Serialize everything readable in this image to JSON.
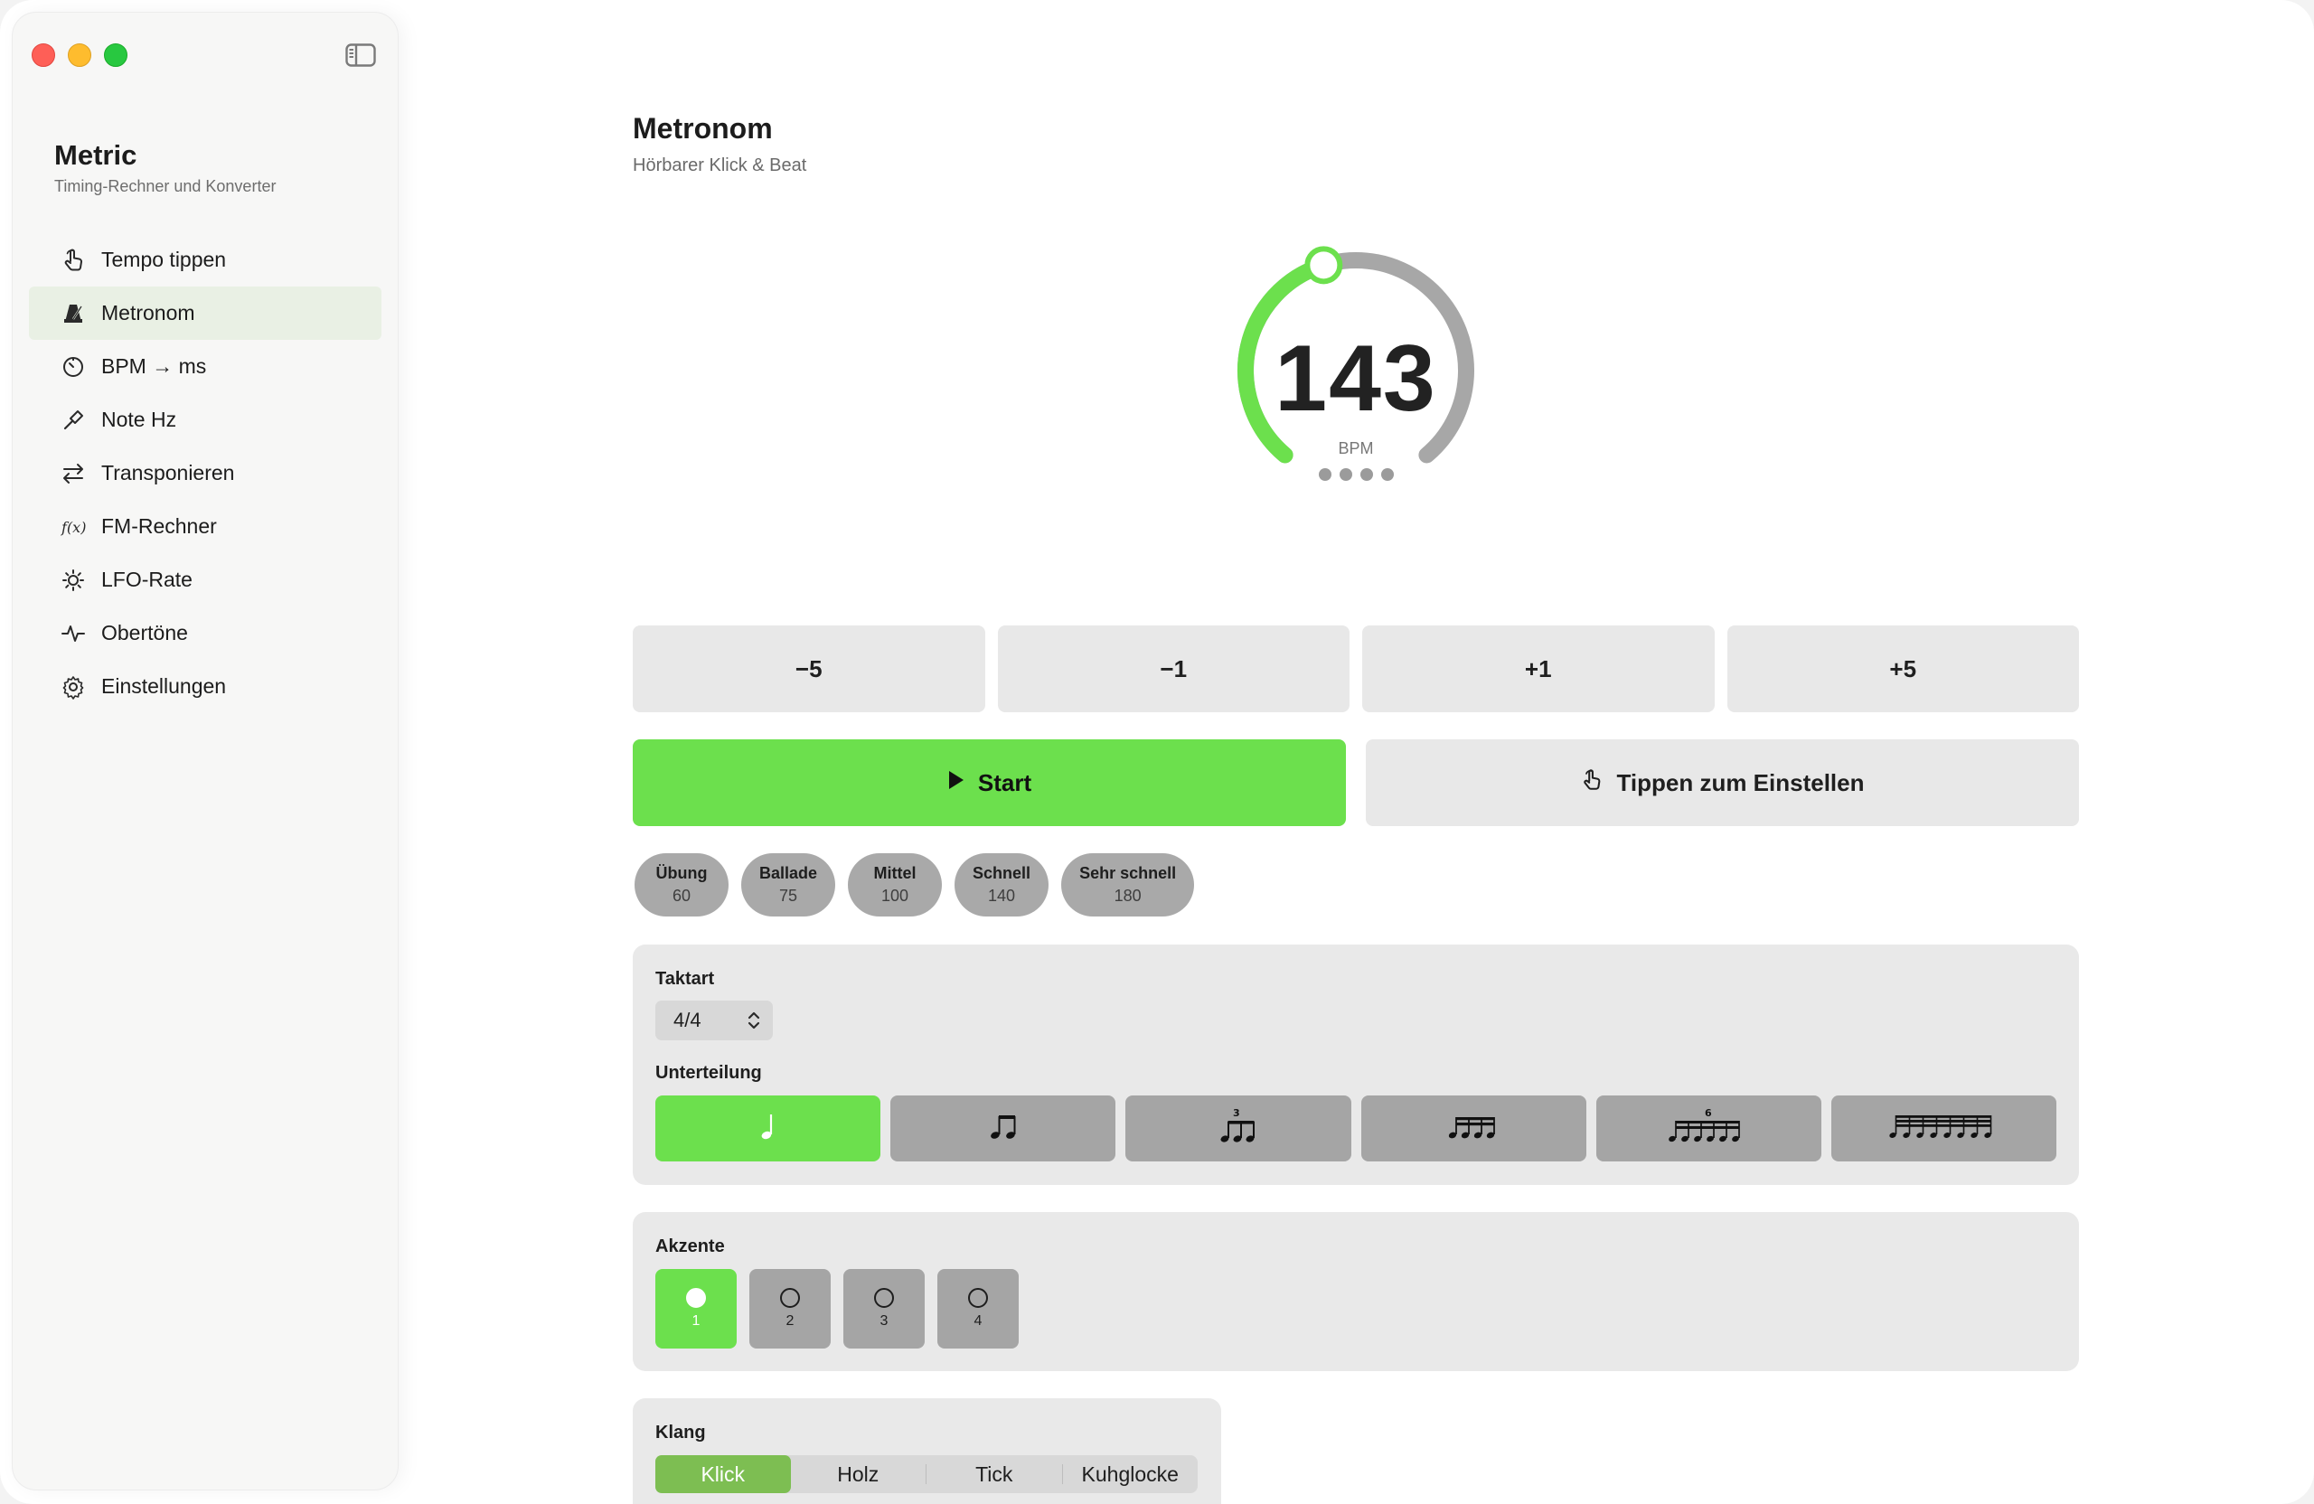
{
  "app": {
    "title": "Metric",
    "subtitle": "Timing-Rechner und Konverter"
  },
  "sidebar": {
    "items": [
      {
        "label": "Tempo tippen",
        "icon": "tap-hand-icon",
        "active": false
      },
      {
        "label": "Metronom",
        "icon": "metronome-icon",
        "active": true
      },
      {
        "label": "BPM → ms",
        "icon": "timer-icon",
        "active": false
      },
      {
        "label": "Note Hz",
        "icon": "tuning-fork-icon",
        "active": false
      },
      {
        "label": "Transponieren",
        "icon": "arrows-swap-icon",
        "active": false
      },
      {
        "label": "FM-Rechner",
        "icon": "function-icon",
        "active": false
      },
      {
        "label": "LFO-Rate",
        "icon": "sun-wave-icon",
        "active": false
      },
      {
        "label": "Obertöne",
        "icon": "waveform-icon",
        "active": false
      },
      {
        "label": "Einstellungen",
        "icon": "gear-icon",
        "active": false
      }
    ]
  },
  "main": {
    "title": "Metronom",
    "subtitle": "Hörbarer Klick & Beat",
    "bpm": {
      "value": "143",
      "unit": "BPM",
      "range_min": 20,
      "range_max": 300,
      "beats": 4
    },
    "steps": [
      "−5",
      "−1",
      "+1",
      "+5"
    ],
    "start_label": "Start",
    "tap_label": "Tippen zum Einstellen",
    "presets": [
      {
        "name": "Übung",
        "bpm": "60"
      },
      {
        "name": "Ballade",
        "bpm": "75"
      },
      {
        "name": "Mittel",
        "bpm": "100"
      },
      {
        "name": "Schnell",
        "bpm": "140"
      },
      {
        "name": "Sehr schnell",
        "bpm": "180"
      }
    ],
    "meter": {
      "label": "Taktart",
      "value": "4/4",
      "subdivision_label": "Unterteilung",
      "subdivisions": [
        {
          "name": "quarter-note-icon",
          "active": true
        },
        {
          "name": "eighth-notes-icon",
          "active": false
        },
        {
          "name": "triplet-icon",
          "active": false
        },
        {
          "name": "sixteenth-notes-icon",
          "active": false
        },
        {
          "name": "sextuplet-icon",
          "active": false
        },
        {
          "name": "thirty-second-notes-icon",
          "active": false
        }
      ],
      "triplet_number": "3",
      "sextuplet_number": "6"
    },
    "accents": {
      "label": "Akzente",
      "beats": [
        {
          "num": "1",
          "active": true
        },
        {
          "num": "2",
          "active": false
        },
        {
          "num": "3",
          "active": false
        },
        {
          "num": "4",
          "active": false
        }
      ]
    },
    "sound": {
      "label": "Klang",
      "options": [
        "Klick",
        "Holz",
        "Tick",
        "Kuhglocke"
      ],
      "selected": "Klick"
    }
  },
  "colors": {
    "accent_green": "#6ce04d",
    "track_gray": "#a7a7a7",
    "segment_selected": "#7dbe52"
  }
}
